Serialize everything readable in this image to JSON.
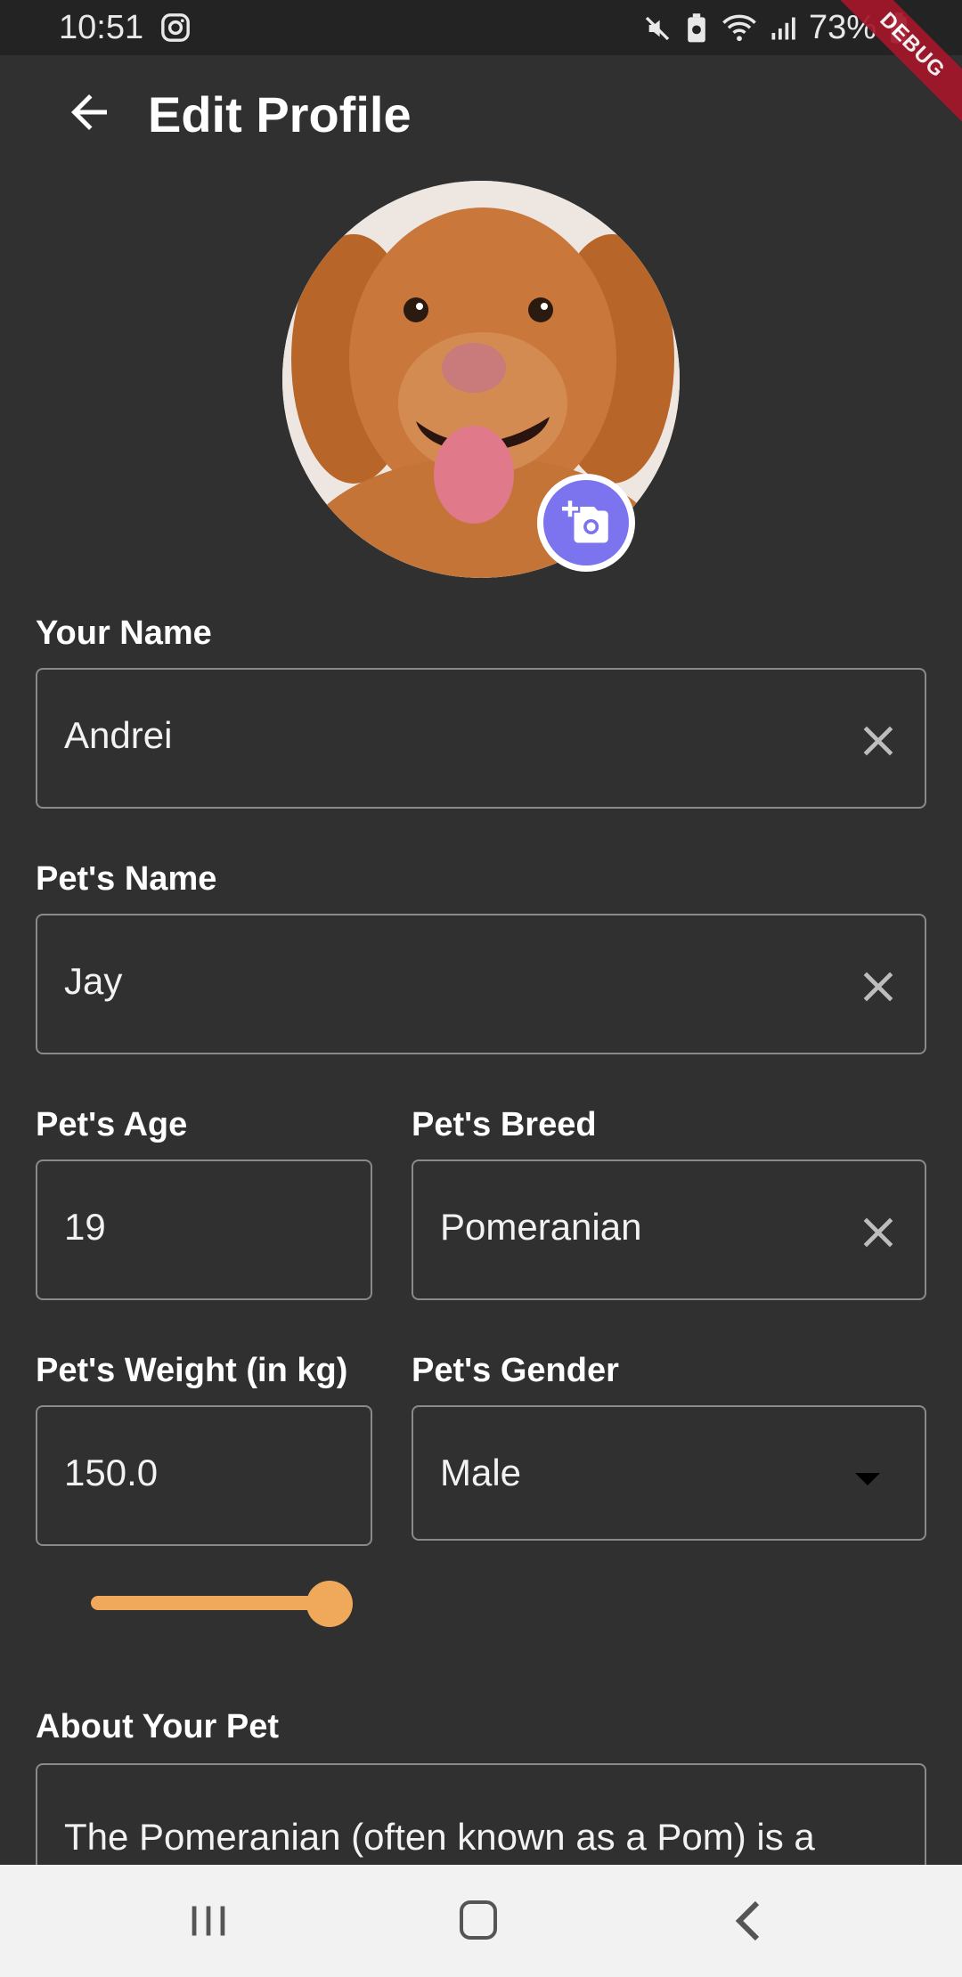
{
  "status_bar": {
    "time": "10:51",
    "battery": "73%",
    "icons": [
      "instagram-icon",
      "mute-icon",
      "battery-saver-icon",
      "wifi-icon",
      "signal-icon",
      "battery-icon"
    ]
  },
  "debug_banner": "DEBUG",
  "app_bar": {
    "title": "Edit Profile",
    "back_icon": "arrow-left-icon"
  },
  "avatar": {
    "camera_icon": "add-a-photo-icon",
    "camera_color": "#7c73ee"
  },
  "form": {
    "your_name": {
      "label": "Your Name",
      "value": "Andrei"
    },
    "pet_name": {
      "label": "Pet's Name",
      "value": "Jay"
    },
    "pet_age": {
      "label": "Pet's Age",
      "value": "19"
    },
    "pet_breed": {
      "label": "Pet's Breed",
      "value": "Pomeranian"
    },
    "pet_weight": {
      "label": "Pet's Weight (in kg)",
      "value": "150.0"
    },
    "pet_gender": {
      "label": "Pet's Gender",
      "value": "Male"
    },
    "weight_slider": {
      "level": 1.0,
      "color": "#f0a95a"
    },
    "about": {
      "label": "About Your Pet",
      "value": "The Pomeranian (often known as a Pom) is a breed of dog of the Spitz type"
    }
  },
  "nav_bar": {
    "icons": [
      "recents-icon",
      "home-icon",
      "back-icon"
    ]
  }
}
